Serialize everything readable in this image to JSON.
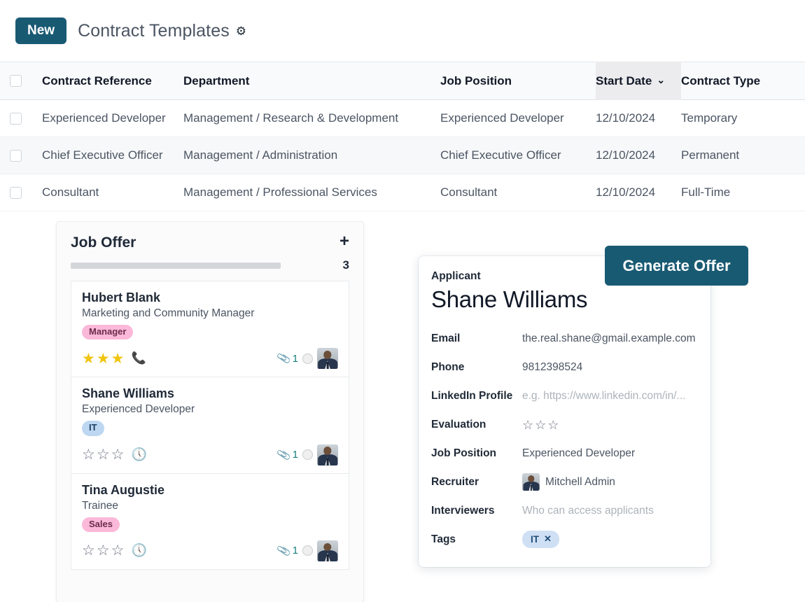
{
  "header": {
    "new_button": "New",
    "title": "Contract Templates",
    "gear_icon": "gear-icon"
  },
  "list": {
    "columns": [
      "Contract Reference",
      "Department",
      "Job Position",
      "Start Date",
      "Contract Type"
    ],
    "sorted_column": "Start Date",
    "sort_caret": "⌄",
    "rows": [
      {
        "reference": "Experienced Developer",
        "department": "Management / Research & Development",
        "job_position": "Experienced Developer",
        "start_date": "12/10/2024",
        "contract_type": "Temporary"
      },
      {
        "reference": "Chief Executive Officer",
        "department": "Management / Administration",
        "job_position": "Chief Executive Officer",
        "start_date": "12/10/2024",
        "contract_type": "Permanent"
      },
      {
        "reference": "Consultant",
        "department": "Management / Professional Services",
        "job_position": "Consultant",
        "start_date": "12/10/2024",
        "contract_type": "Full-Time"
      }
    ]
  },
  "kanban": {
    "stage_title": "Job Offer",
    "add_icon": "plus-icon",
    "count": "3",
    "cards": [
      {
        "name": "Hubert Blank",
        "role": "Marketing and Community Manager",
        "tag": "Manager",
        "tag_color": "#fbb8d8",
        "stars_filled": 3,
        "activity_icon": "phone-icon",
        "attachment_count": "1"
      },
      {
        "name": "Shane Williams",
        "role": "Experienced Developer",
        "tag": "IT",
        "tag_color": "#bdd7f2",
        "stars_filled": 0,
        "activity_icon": "clock-icon",
        "attachment_count": "1"
      },
      {
        "name": "Tina Augustie",
        "role": "Trainee",
        "tag": "Sales",
        "tag_color": "#fbb8d8",
        "stars_filled": 0,
        "activity_icon": "clock-icon",
        "attachment_count": "1"
      }
    ]
  },
  "applicant": {
    "subtitle": "Applicant",
    "name": "Shane Williams",
    "fields": {
      "email_label": "Email",
      "email_value": "the.real.shane@gmail.example.com",
      "phone_label": "Phone",
      "phone_value": "9812398524",
      "linkedin_label": "LinkedIn Profile",
      "linkedin_placeholder": "e.g. https://www.linkedin.com/in/...",
      "evaluation_label": "Evaluation",
      "evaluation_stars": 0,
      "job_position_label": "Job Position",
      "job_position_value": "Experienced Developer",
      "recruiter_label": "Recruiter",
      "recruiter_value": "Mitchell Admin",
      "interviewers_label": "Interviewers",
      "interviewers_placeholder": "Who can access applicants",
      "tags_label": "Tags",
      "tag_value": "IT",
      "tag_remove": "✕"
    }
  },
  "actions": {
    "generate_offer": "Generate Offer"
  },
  "colors": {
    "accent": "#195a73",
    "tag_pink": "#fbb8d8",
    "tag_blue": "#bdd7f2",
    "star_gold": "#f1c40f",
    "phone_green": "#1a8a3a"
  }
}
